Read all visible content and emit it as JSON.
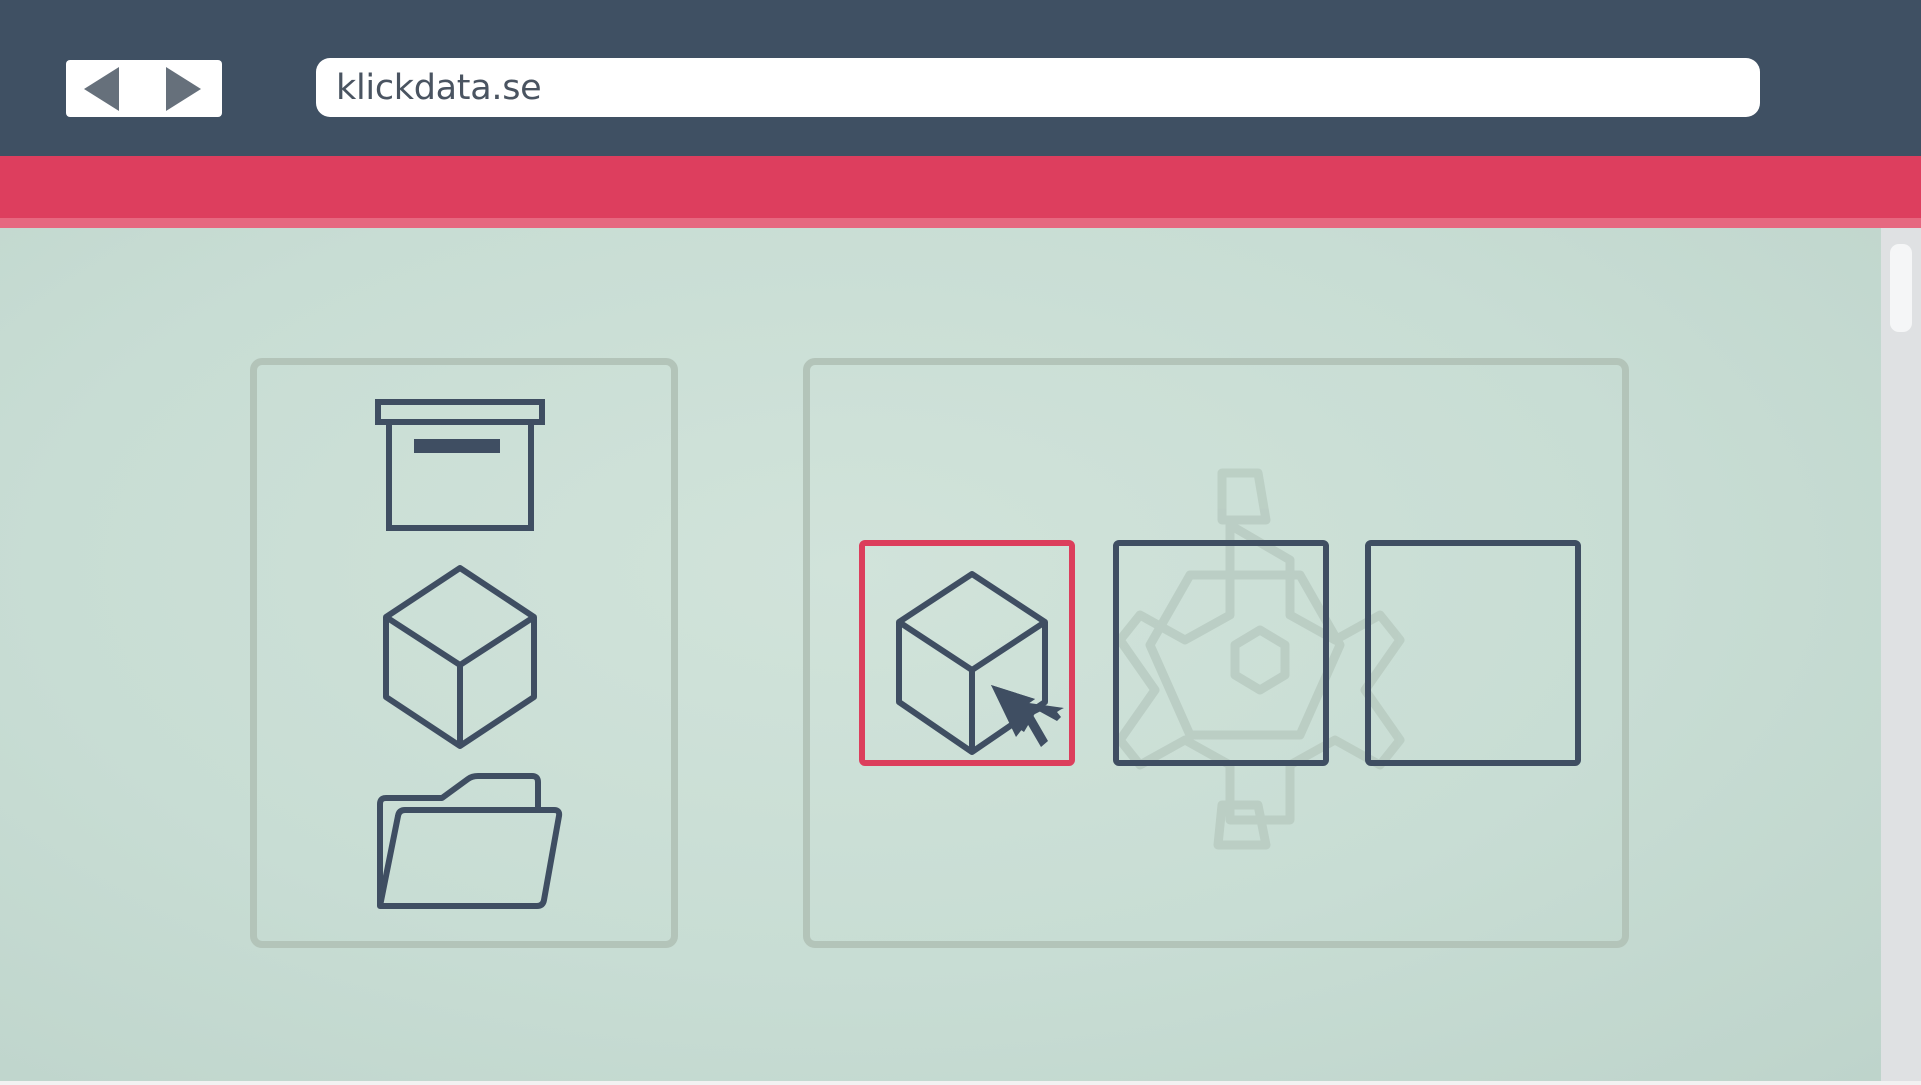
{
  "browser": {
    "address": "klickdata.se",
    "nav": {
      "back_icon": "back-arrow-icon",
      "forward_icon": "forward-arrow-icon"
    }
  },
  "colors": {
    "toolbar": "#3f5063",
    "accent": "#dd3e5e",
    "content_bg": "#c9ddd4",
    "icon_stroke": "#3f4e62",
    "selected_border": "#dc3e5c",
    "panel_border": "#b3c4b9"
  },
  "sidebar_panel": {
    "icons": [
      "archive-box-icon",
      "cube-icon",
      "folder-open-icon"
    ]
  },
  "main_panel": {
    "background_icon": "gear-icon",
    "tiles": [
      {
        "icon": "cube-icon",
        "selected": true
      },
      {
        "icon": "",
        "selected": false
      },
      {
        "icon": "",
        "selected": false
      }
    ],
    "cursor_icon": "mouse-pointer-icon"
  }
}
